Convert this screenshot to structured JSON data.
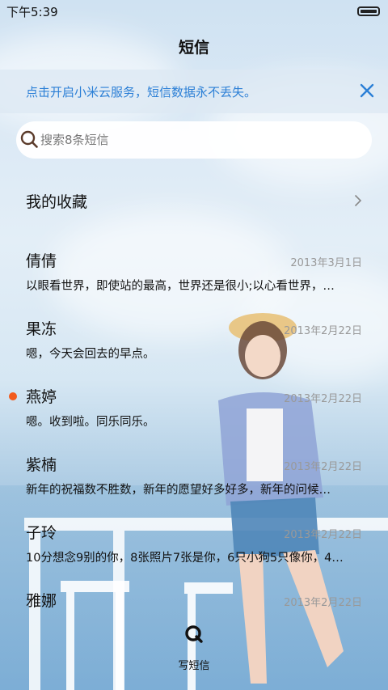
{
  "status_bar": {
    "time": "下午5:39"
  },
  "header": {
    "title": "短信"
  },
  "banner": {
    "text": "点击开启小米云服务，短信数据永不丢失。"
  },
  "search": {
    "placeholder": "搜索8条短信"
  },
  "favorites": {
    "label": "我的收藏"
  },
  "conversations": [
    {
      "name": "倩倩",
      "date": "2013年3月1日",
      "preview": "以眼看世界，即使站的最高，世界还是很小;以心看世界，…",
      "unread": false
    },
    {
      "name": "果冻",
      "date": "2013年2月22日",
      "preview": "嗯，今天会回去的早点。",
      "unread": false
    },
    {
      "name": "燕婷",
      "date": "2013年2月22日",
      "preview": "嗯。收到啦。同乐同乐。",
      "unread": true
    },
    {
      "name": "紫楠",
      "date": "2013年2月22日",
      "preview": "新年的祝福数不胜数，新年的愿望好多好多，新年的问候…",
      "unread": false
    },
    {
      "name": "子玲",
      "date": "2013年2月22日",
      "preview": "10分想念9别的你，8张照片7张是你，6只小狗5只像你，4…",
      "unread": false
    },
    {
      "name": "雅娜",
      "date": "2013年2月22日",
      "preview": "",
      "unread": false
    }
  ],
  "compose": {
    "label": "写短信",
    "icon": "compose-icon"
  },
  "colors": {
    "accent": "#2b7fd6",
    "unread": "#f25a1c",
    "date": "#999999"
  }
}
